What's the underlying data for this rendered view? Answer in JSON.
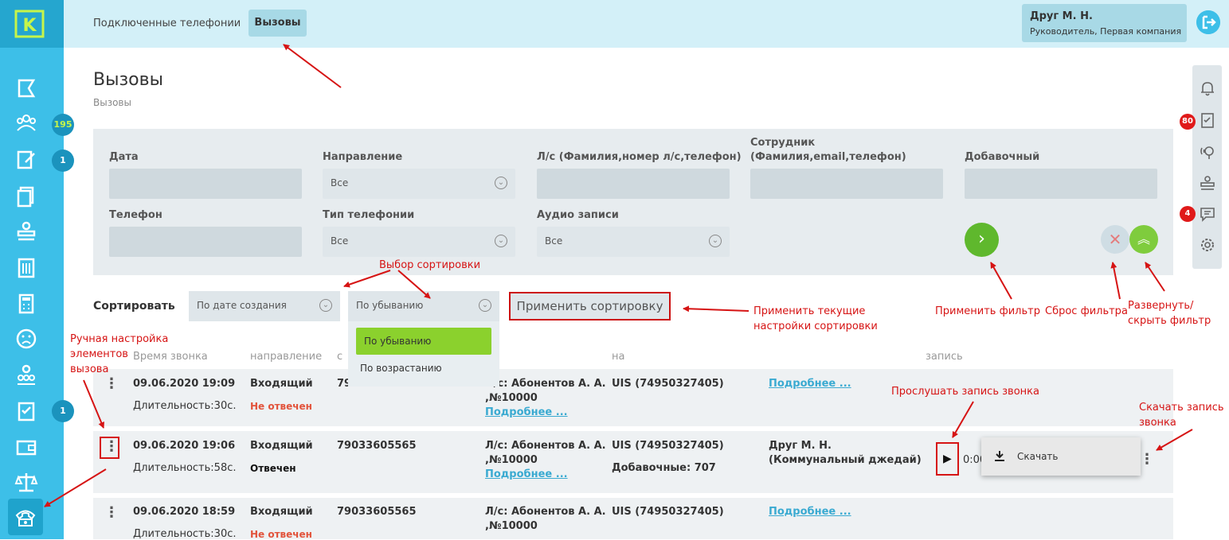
{
  "header": {
    "nav": [
      "Подключенные телефонии",
      "Вызовы"
    ],
    "user": {
      "name": "Друг М. Н.",
      "role": "Руководитель, Первая компания"
    }
  },
  "sidebar": {
    "logo": "K",
    "badges": [
      "195",
      "1",
      "1"
    ]
  },
  "page": {
    "title": "Вызовы",
    "breadcrumb": "Вызовы"
  },
  "filter": {
    "labels": {
      "date": "Дата",
      "direction": "Направление",
      "account": "Л/с (Фамилия,номер л/с,телефон)",
      "employee_1": "Сотрудник",
      "employee_2": "(Фамилия,email,телефон)",
      "ext": "Добавочный",
      "phone": "Телефон",
      "phone_type": "Тип телефонии",
      "audio": "Аудио записи"
    },
    "direction_value": "Все",
    "phone_type_value": "Все",
    "audio_value": "Все"
  },
  "rail": {
    "badge_tasks": "80",
    "badge_messages": "4"
  },
  "sort": {
    "label": "Сортировать",
    "field": "По дате создания",
    "order": "По убыванию",
    "apply": "Применить сортировку",
    "options": [
      "По убыванию",
      "По возрастанию"
    ]
  },
  "table": {
    "headers": [
      "Время звонка",
      "направление",
      "с",
      "на",
      "запись"
    ]
  },
  "rows": [
    {
      "time": "09.06.2020 19:09",
      "duration": "Длительность:30с.",
      "dir": "Входящий",
      "status": "Не отвечен",
      "from": "79033605565",
      "acc1": "Л/с: Абонентов А. А.",
      "acc2": ",№10000",
      "more": "Подробнее ...",
      "to": "UIS (74950327405)",
      "who_link": "Подробнее ..."
    },
    {
      "time": "09.06.2020 19:06",
      "duration": "Длительность:58с.",
      "dir": "Входящий",
      "status": "Отвечен",
      "from": "79033605565",
      "acc1": "Л/с: Абонентов А. А.",
      "acc2": ",№10000",
      "more": "Подробнее ...",
      "to": "UIS (74950327405)",
      "ext": "Добавочные: 707",
      "who1": "Друг М. Н.",
      "who2": "(Коммунальный джедай)",
      "player_time": "0:00",
      "download": "Скачать"
    },
    {
      "time": "09.06.2020 18:59",
      "duration": "Длительность:30с.",
      "dir": "Входящий",
      "status": "Не отвечен",
      "from": "79033605565",
      "acc1": "Л/с: Абонентов А. А.",
      "acc2": ",№10000",
      "more": "Подробнее ...",
      "to": "UIS (74950327405)",
      "who_link": "Подробнее ..."
    }
  ],
  "annotations": {
    "sort_choice": "Выбор сортировки",
    "apply_sort_1": "Применить текущие",
    "apply_sort_2": "настройки сортировки",
    "apply_filter": "Применить фильтр",
    "reset_filter": "Сброс фильтра",
    "toggle_filter_1": "Развернуть/",
    "toggle_filter_2": "скрыть фильтр",
    "manual_1": "Ручная настройка",
    "manual_2": "элементов",
    "manual_3": "вызова",
    "listen": "Прослушать запись звонка",
    "download_1": "Скачать запись",
    "download_2": "звонка"
  },
  "colors": {
    "sidebar": "#3dbfe8",
    "header": "#d3f0f8",
    "accent_green": "#5fb82d",
    "annotation_red": "#d61414",
    "link": "#3aaad1"
  }
}
